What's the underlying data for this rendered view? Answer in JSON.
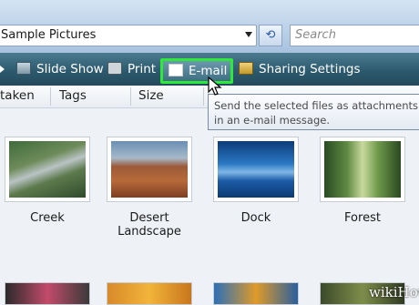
{
  "address": {
    "path": "Sample Pictures",
    "search_placeholder": "Search"
  },
  "toolbar": {
    "slideshow_label": "Slide Show",
    "print_label": "Print",
    "email_label": "E-mail",
    "sharing_label": "Sharing Settings"
  },
  "columns": [
    "taken",
    "Tags",
    "Size"
  ],
  "tooltip": "Send the selected files as attachments in an e-mail message.",
  "files": [
    {
      "name": "Creek"
    },
    {
      "name": "Desert Landscape"
    },
    {
      "name": "Dock"
    },
    {
      "name": "Forest"
    }
  ],
  "watermark": "wikiHow",
  "colors": {
    "highlight": "#2ee83a",
    "toolbar": "#2d5a6e"
  }
}
